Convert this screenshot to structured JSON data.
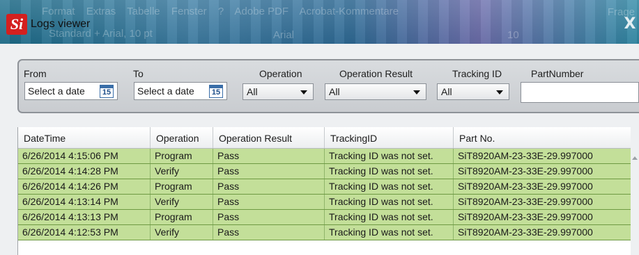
{
  "background_app": {
    "menu": [
      "Format",
      "Extras",
      "Tabelle",
      "Fenster",
      "?",
      "Adobe PDF",
      "Acrobat-Kommentare"
    ],
    "help": "Frage",
    "style_box": "Standard + Arial, 10 pt",
    "font_box": "Arial",
    "size_box": "10"
  },
  "window": {
    "logo": "Si",
    "title": "Logs viewer",
    "close": "X"
  },
  "filters": {
    "from_label": "From",
    "from_value": "Select a date",
    "to_label": "To",
    "to_value": "Select a date",
    "calendar_day": "15",
    "operation_label": "Operation",
    "operation_value": "All",
    "result_label": "Operation Result",
    "result_value": "All",
    "tracking_label": "Tracking ID",
    "tracking_value": "All",
    "part_label": "PartNumber",
    "part_value": ""
  },
  "grid": {
    "columns": [
      "DateTime",
      "Operation",
      "Operation Result",
      "TrackingID",
      "Part No."
    ],
    "rows": [
      [
        "6/26/2014 4:15:06 PM",
        "Program",
        "Pass",
        "Tracking ID was not set.",
        "SiT8920AM-23-33E-29.997000"
      ],
      [
        "6/26/2014 4:14:28 PM",
        "Verify",
        "Pass",
        "Tracking ID was not set.",
        "SiT8920AM-23-33E-29.997000"
      ],
      [
        "6/26/2014 4:14:26 PM",
        "Program",
        "Pass",
        "Tracking ID was not set.",
        "SiT8920AM-23-33E-29.997000"
      ],
      [
        "6/26/2014 4:13:14 PM",
        "Verify",
        "Pass",
        "Tracking ID was not set.",
        "SiT8920AM-23-33E-29.997000"
      ],
      [
        "6/26/2014 4:13:13 PM",
        "Program",
        "Pass",
        "Tracking ID was not set.",
        "SiT8920AM-23-33E-29.997000"
      ],
      [
        "6/26/2014 4:12:53 PM",
        "Verify",
        "Pass",
        "Tracking ID was not set.",
        "SiT8920AM-23-33E-29.997000"
      ]
    ]
  },
  "colors": {
    "row_pass": "#c3df99",
    "logo_red": "#d4201f"
  }
}
